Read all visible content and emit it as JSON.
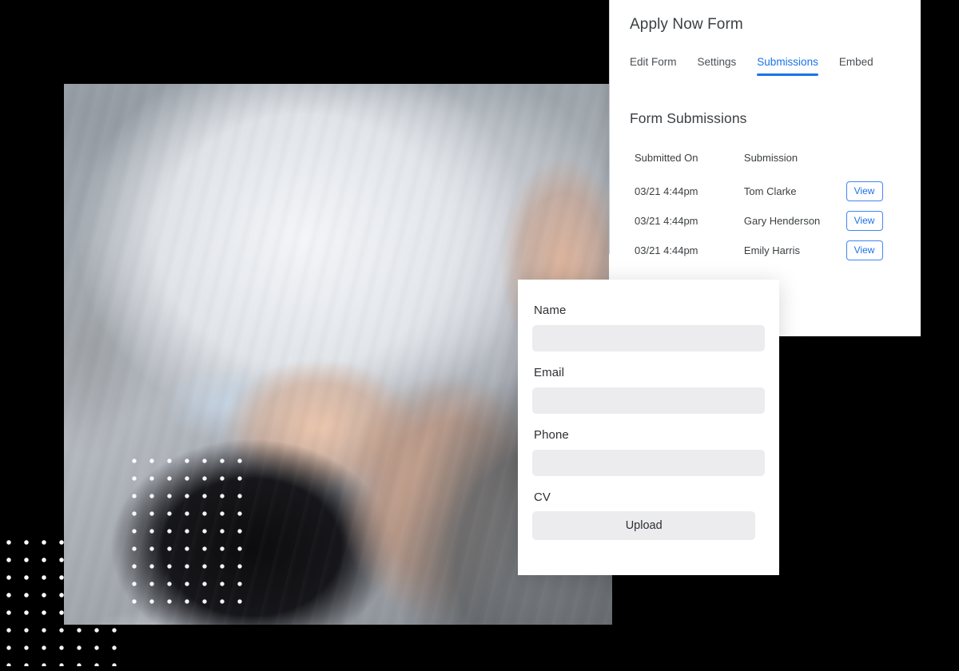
{
  "builder": {
    "title": "Apply Now Form",
    "tabs": [
      {
        "label": "Edit Form",
        "active": false
      },
      {
        "label": "Settings",
        "active": false
      },
      {
        "label": "Submissions",
        "active": true
      },
      {
        "label": "Embed",
        "active": false
      }
    ],
    "section_heading": "Form Submissions",
    "table": {
      "headers": {
        "submitted_on": "Submitted On",
        "submission": "Submission",
        "action": ""
      },
      "rows": [
        {
          "submitted_on": "03/21 4:44pm",
          "submission": "Tom Clarke",
          "action": "View"
        },
        {
          "submitted_on": "03/21 4:44pm",
          "submission": "Gary Henderson",
          "action": "View"
        },
        {
          "submitted_on": "03/21 4:44pm",
          "submission": "Emily Harris",
          "action": "View"
        }
      ]
    }
  },
  "apply_form": {
    "fields": [
      {
        "label": "Name",
        "value": "",
        "placeholder": ""
      },
      {
        "label": "Email",
        "value": "",
        "placeholder": ""
      },
      {
        "label": "Phone",
        "value": "",
        "placeholder": ""
      }
    ],
    "cv_label": "CV",
    "upload_label": "Upload"
  },
  "photo": {
    "alt": "Chiropractor in a white lab coat adjusting a patient's neck"
  },
  "colors": {
    "accent_blue": "#1a73e8",
    "button_border_blue": "#4285f4",
    "text_primary": "#3c4043",
    "input_fill": "#ececee",
    "card_white": "#ffffff",
    "background": "#000000"
  }
}
